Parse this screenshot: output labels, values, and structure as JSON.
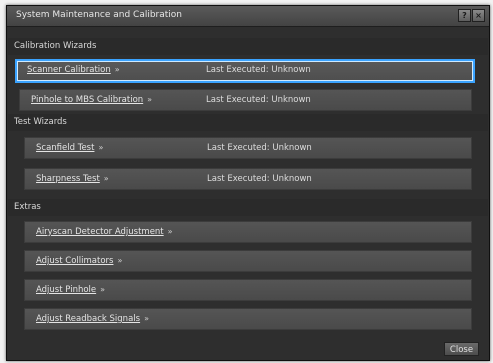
{
  "window": {
    "title": "System Maintenance and Calibration",
    "help_label": "?",
    "close_x_label": "×"
  },
  "sections": {
    "calibration": "Calibration Wizards",
    "tests": "Test Wizards",
    "extras": "Extras"
  },
  "rows": {
    "scanner_calibration": {
      "label": "Scanner Calibration",
      "chevron": "»",
      "exec": "Last Executed:  Unknown"
    },
    "pinhole_mbs": {
      "label": "Pinhole to MBS Calibration",
      "chevron": "»",
      "exec": "Last Executed:  Unknown"
    },
    "scanfield_test": {
      "label": "Scanfield Test",
      "chevron": "»",
      "exec": "Last Executed:  Unknown"
    },
    "sharpness_test": {
      "label": "Sharpness Test",
      "chevron": "»",
      "exec": "Last Executed:  Unknown"
    },
    "airyscan": {
      "label": "Airyscan Detector Adjustment",
      "chevron": "»"
    },
    "collimators": {
      "label": "Adjust Collimators",
      "chevron": "»"
    },
    "pinhole": {
      "label": "Adjust Pinhole",
      "chevron": "»"
    },
    "readback": {
      "label": "Adjust Readback Signals",
      "chevron": "»"
    }
  },
  "footer": {
    "close_label": "Close"
  },
  "colors": {
    "selection_border": "#3aa3ff",
    "window_bg": "#2e2e2e",
    "row_bg": "#4f4f4f"
  }
}
